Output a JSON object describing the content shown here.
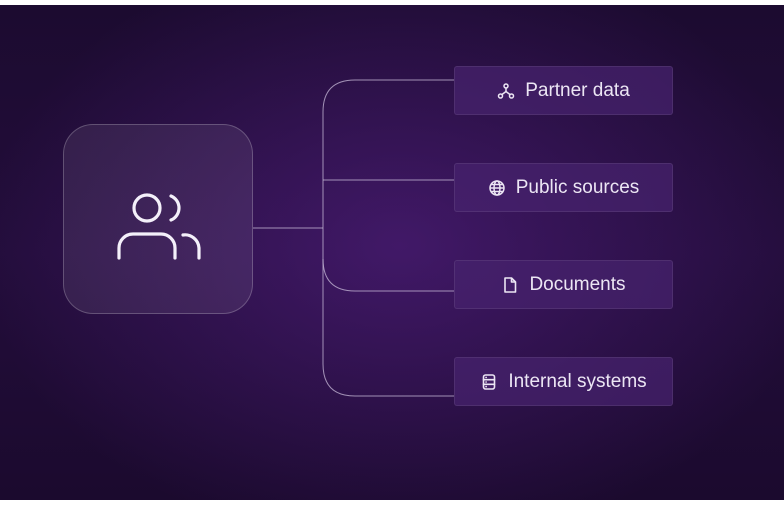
{
  "diagram": {
    "hub": {
      "icon": "users-icon"
    },
    "sources": [
      {
        "label": "Partner data",
        "icon": "network-icon"
      },
      {
        "label": "Public sources",
        "icon": "globe-icon"
      },
      {
        "label": "Documents",
        "icon": "document-icon"
      },
      {
        "label": "Internal systems",
        "icon": "database-icon"
      }
    ],
    "colors": {
      "background": "#230d3b",
      "node_fill": "#46226e",
      "line": "#c9bcd9",
      "text": "#ece6f4"
    }
  }
}
